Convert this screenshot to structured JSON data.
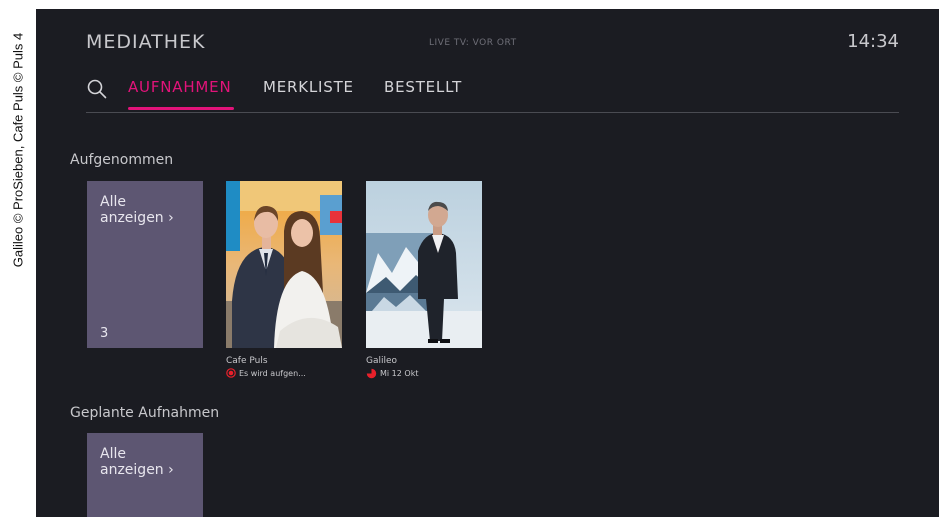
{
  "credit": "Galileo © ProSieben, Cafe Puls © Puls 4",
  "header": {
    "title": "MEDIATHEK",
    "live_tv": "LIVE TV: VOR ORT",
    "time": "14:34"
  },
  "tabs": [
    {
      "label": "AUFNAHMEN",
      "active": true
    },
    {
      "label": "MERKLISTE",
      "active": false
    },
    {
      "label": "BESTELLT",
      "active": false
    }
  ],
  "sections": {
    "recorded": {
      "heading": "Aufgenommen",
      "show_all": "Alle\nanzeigen ›",
      "count": "3",
      "items": [
        {
          "title": "Cafe Puls",
          "status": "Es wird aufgen...",
          "status_icon": "recording-icon"
        },
        {
          "title": "Galileo",
          "status": "Mi 12 Okt",
          "status_icon": "partial-pie-icon"
        }
      ]
    },
    "planned": {
      "heading": "Geplante Aufnahmen",
      "show_all": "Alle\nanzeigen ›"
    }
  },
  "colors": {
    "accent": "#e2137a",
    "background": "#1b1c22",
    "tile": "#5d5672",
    "record_red": "#e8202a"
  }
}
